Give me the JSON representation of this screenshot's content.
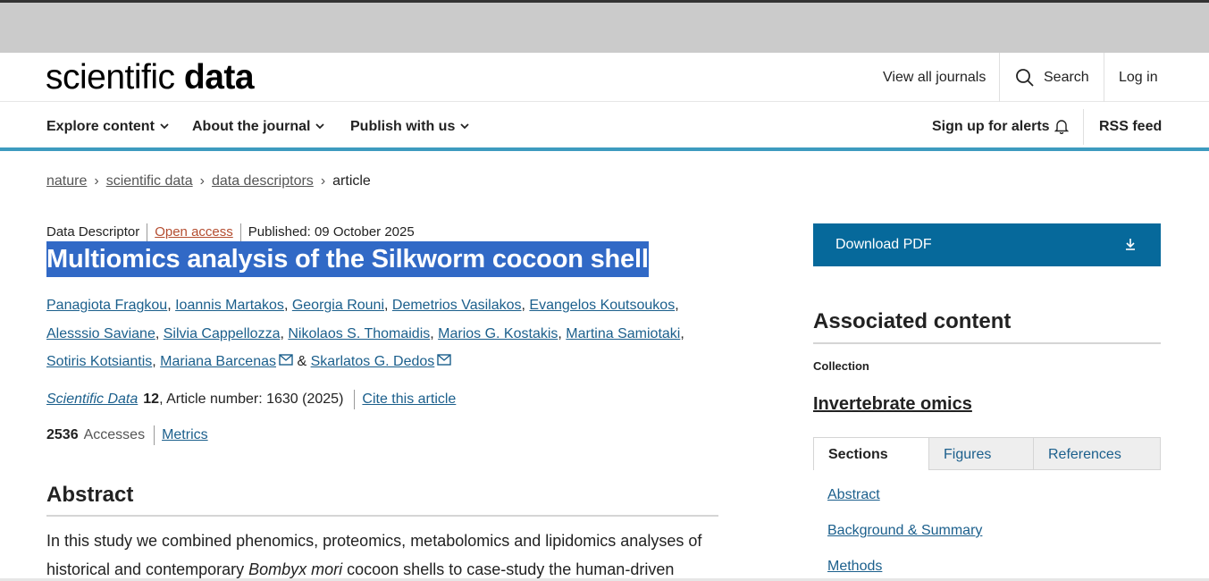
{
  "header": {
    "logo_light": "scientific",
    "logo_bold": "data",
    "view_all_journals": "View all journals",
    "search_label": "Search",
    "login_label": "Log in"
  },
  "nav": {
    "explore": "Explore content",
    "about": "About the journal",
    "publish": "Publish with us",
    "alerts": "Sign up for alerts",
    "rss": "RSS feed"
  },
  "breadcrumb": {
    "items": [
      "nature",
      "scientific data",
      "data descriptors"
    ],
    "current": "article"
  },
  "article": {
    "type": "Data Descriptor",
    "access": "Open access",
    "published": "Published: 09 October 2025",
    "title": "Multiomics analysis of the Silkworm cocoon shell",
    "authors": [
      "Panagiota Fragkou",
      "Ioannis Martakos",
      "Georgia Rouni",
      "Demetrios Vasilakos",
      "Evangelos Koutsoukos",
      "Alesssio Saviane",
      "Silvia Cappellozza",
      "Nikolaos S. Thomaidis",
      "Marios G. Kostakis",
      "Martina Samiotaki",
      "Sotiris Kotsiantis",
      "Mariana Barcenas",
      "Skarlatos G. Dedos"
    ],
    "author_joiner": "&",
    "journal": "Scientific Data",
    "volume": "12",
    "article_number": ", Article number: 1630 (2025)",
    "cite": "Cite this article",
    "accesses_count": "2536",
    "accesses_label": "Accesses",
    "metrics_link": "Metrics",
    "abstract_heading": "Abstract",
    "abstract_part1": "In this study we combined phenomics, proteomics, metabolomics and lipidomics analyses of historical and contemporary ",
    "abstract_italic": "Bombyx mori",
    "abstract_part2": " cocoon shells to case-study the human-driven"
  },
  "sidebar": {
    "download_pdf": "Download PDF",
    "associated_heading": "Associated content",
    "collection_label": "Collection",
    "collection_name": "Invertebrate omics",
    "tabs": [
      "Sections",
      "Figures",
      "References"
    ],
    "section_links": [
      "Abstract",
      "Background & Summary",
      "Methods"
    ]
  },
  "colors": {
    "accent": "#06699b",
    "nav_border": "#3d9bbf",
    "title_highlight": "#3169c6",
    "link": "#1b5f8c",
    "open_access": "#b44d30"
  }
}
